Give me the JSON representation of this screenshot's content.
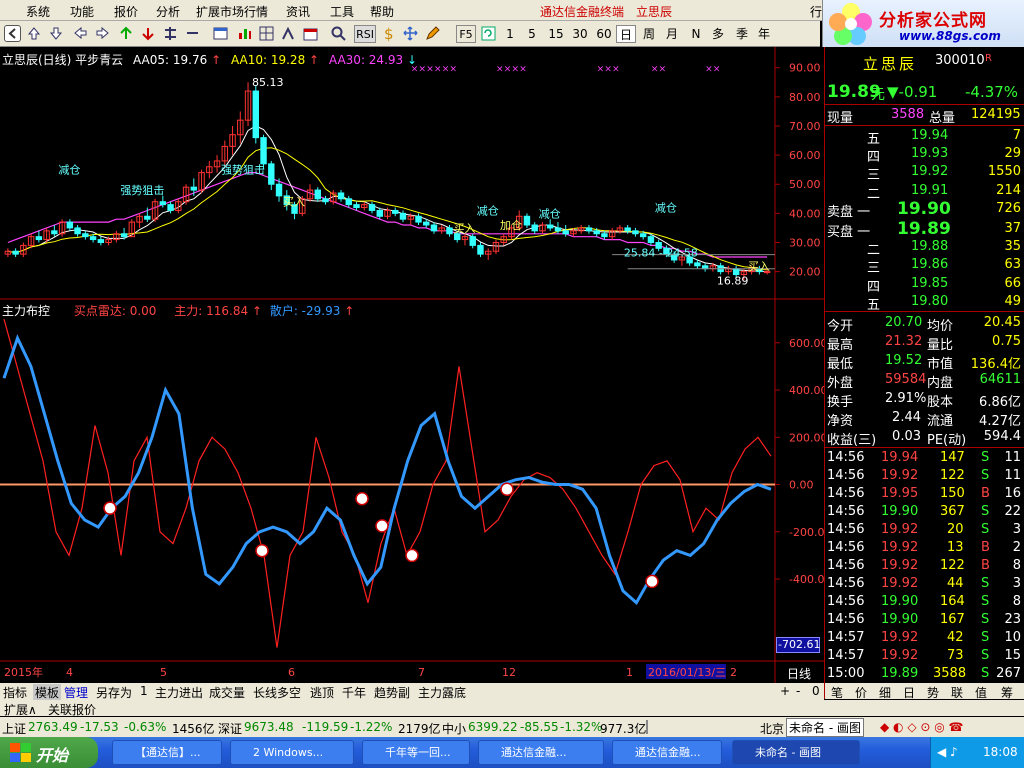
{
  "menubar": {
    "items": [
      "系统",
      "功能",
      "报价",
      "分析",
      "扩展市场行情",
      "资讯",
      "工具",
      "帮助"
    ],
    "app_title": "通达信金融终端",
    "stock_tag": "立思辰",
    "right_cut": "行"
  },
  "toolbar": {
    "buttons": [
      "RSI",
      "F5",
      "1",
      "5",
      "15",
      "30",
      "60",
      "日",
      "周",
      "月",
      "N",
      "多",
      "季",
      "年"
    ]
  },
  "logo": {
    "text": "分析家公式网",
    "url": "www.88gs.com"
  },
  "main_legend": {
    "title": "立思辰(日线) 平步青云",
    "aa05": "AA05: 19.76",
    "aa10": "AA10: 19.28",
    "aa30": "AA30: 24.93"
  },
  "sub_legend": {
    "title": "主力布控",
    "radar": "买点雷达: 0.00",
    "main": "主力: 116.84",
    "retail": "散户: -29.93"
  },
  "colors": {
    "up": "#ff3333",
    "down": "#33ffff",
    "aa05": "#ffffff",
    "aa10": "#ffff00",
    "aa30": "#ff44ff",
    "main_line": "#ff2020",
    "retail_line": "#3399ff",
    "grid": "#aa0000"
  },
  "chart_data": [
    {
      "type": "candlestick",
      "title": "立思辰(日线) 平步青云",
      "y_ticks": [
        90.0,
        80.0,
        70.0,
        60.0,
        50.0,
        40.0,
        30.0,
        20.0
      ],
      "ylim": [
        13,
        93
      ],
      "candles": [
        [
          26,
          28,
          25,
          27
        ],
        [
          27,
          28,
          25,
          26
        ],
        [
          26,
          30,
          25,
          29
        ],
        [
          29,
          33,
          28,
          32
        ],
        [
          32,
          34,
          30,
          31
        ],
        [
          31,
          35,
          30,
          34
        ],
        [
          34,
          36,
          32,
          33
        ],
        [
          33,
          38,
          32,
          37
        ],
        [
          37,
          38,
          34,
          35
        ],
        [
          35,
          36,
          32,
          33
        ],
        [
          33,
          34,
          31,
          32
        ],
        [
          32,
          33,
          30,
          31
        ],
        [
          31,
          32,
          29,
          30
        ],
        [
          30,
          32,
          29,
          31
        ],
        [
          31,
          34,
          30,
          33
        ],
        [
          33,
          35,
          31,
          32
        ],
        [
          32,
          38,
          32,
          37
        ],
        [
          37,
          40,
          35,
          39
        ],
        [
          39,
          42,
          37,
          38
        ],
        [
          38,
          45,
          37,
          44
        ],
        [
          44,
          46,
          42,
          43
        ],
        [
          43,
          44,
          40,
          41
        ],
        [
          41,
          45,
          40,
          44
        ],
        [
          44,
          50,
          43,
          49
        ],
        [
          49,
          52,
          46,
          48
        ],
        [
          48,
          55,
          47,
          54
        ],
        [
          54,
          58,
          52,
          56
        ],
        [
          56,
          60,
          54,
          58
        ],
        [
          58,
          65,
          56,
          63
        ],
        [
          63,
          70,
          60,
          67
        ],
        [
          67,
          75,
          64,
          72
        ],
        [
          72,
          85,
          70,
          82
        ],
        [
          82,
          84,
          64,
          66
        ],
        [
          66,
          67,
          55,
          57
        ],
        [
          57,
          58,
          48,
          50
        ],
        [
          50,
          52,
          44,
          46
        ],
        [
          46,
          48,
          41,
          43
        ],
        [
          43,
          44,
          38,
          40
        ],
        [
          40,
          46,
          39,
          45
        ],
        [
          45,
          50,
          44,
          48
        ],
        [
          48,
          49,
          44,
          45
        ],
        [
          45,
          46,
          43,
          44
        ],
        [
          44,
          48,
          43,
          47
        ],
        [
          47,
          48,
          44,
          45
        ],
        [
          45,
          46,
          42,
          43
        ],
        [
          43,
          44,
          41,
          42
        ],
        [
          42,
          44,
          41,
          43
        ],
        [
          43,
          44,
          40,
          41
        ],
        [
          41,
          42,
          38,
          39
        ],
        [
          39,
          42,
          38,
          41
        ],
        [
          41,
          42,
          39,
          40
        ],
        [
          40,
          41,
          37,
          38
        ],
        [
          38,
          40,
          36,
          39
        ],
        [
          39,
          40,
          36,
          37
        ],
        [
          37,
          38,
          35,
          36
        ],
        [
          36,
          37,
          33,
          34
        ],
        [
          34,
          36,
          33,
          35
        ],
        [
          35,
          36,
          32,
          33
        ],
        [
          33,
          34,
          30,
          31
        ],
        [
          31,
          33,
          29,
          32
        ],
        [
          32,
          33,
          28,
          29
        ],
        [
          29,
          30,
          25,
          26
        ],
        [
          26,
          28,
          24,
          27
        ],
        [
          27,
          31,
          26,
          30
        ],
        [
          30,
          33,
          29,
          32
        ],
        [
          32,
          36,
          31,
          35
        ],
        [
          35,
          41,
          34,
          39
        ],
        [
          39,
          40,
          35,
          36
        ],
        [
          36,
          37,
          33,
          34
        ],
        [
          34,
          37,
          33,
          36
        ],
        [
          36,
          38,
          34,
          35
        ],
        [
          35,
          37,
          33,
          34
        ],
        [
          34,
          36,
          32,
          33
        ],
        [
          33,
          35,
          32,
          34
        ],
        [
          34,
          36,
          33,
          35
        ],
        [
          35,
          36,
          33,
          34
        ],
        [
          34,
          35,
          32,
          33
        ],
        [
          33,
          34,
          31,
          32
        ],
        [
          32,
          35,
          31,
          34
        ],
        [
          34,
          36,
          33,
          35
        ],
        [
          35,
          36,
          33,
          34
        ],
        [
          34,
          35,
          32,
          33
        ],
        [
          33,
          34,
          31,
          32
        ],
        [
          32,
          33,
          29,
          30
        ],
        [
          30,
          31,
          27,
          28
        ],
        [
          28,
          29,
          25,
          26
        ],
        [
          26,
          27,
          23,
          24
        ],
        [
          24,
          26,
          22,
          25
        ],
        [
          25,
          26,
          22,
          23
        ],
        [
          23,
          24,
          21,
          22
        ],
        [
          22,
          23,
          20,
          21
        ],
        [
          21,
          23,
          20,
          22
        ],
        [
          22,
          23,
          19,
          20
        ],
        [
          20,
          22,
          19,
          21
        ],
        [
          21,
          22,
          18,
          19
        ],
        [
          19,
          21,
          17,
          20
        ],
        [
          20,
          22,
          19,
          21
        ],
        [
          21,
          22,
          19,
          20
        ],
        [
          20,
          21,
          19,
          20
        ]
      ],
      "aa30_line": [
        30,
        31,
        32,
        33,
        34,
        35,
        36,
        37,
        37,
        37,
        37,
        37,
        37,
        37,
        38,
        38,
        39,
        40,
        41,
        42,
        43,
        44,
        45,
        46,
        47,
        48,
        49,
        50,
        51,
        52,
        53,
        54,
        54,
        53,
        52,
        51,
        50,
        49,
        48,
        47,
        46,
        45,
        44,
        43,
        42,
        41,
        40,
        39,
        38,
        37,
        37,
        36,
        36,
        35,
        35,
        34,
        34,
        34,
        33,
        33,
        33,
        33,
        33,
        33,
        33,
        33,
        33,
        33,
        33,
        33,
        33,
        33,
        33,
        32,
        32,
        32,
        32,
        31,
        31,
        31,
        30,
        30,
        30,
        29,
        29,
        28,
        28,
        27,
        27,
        26,
        26,
        25,
        25,
        25,
        25,
        25,
        25,
        25,
        25
      ],
      "annotations": [
        "85.13",
        "强势狙击",
        "强势狙击",
        "减仓",
        "买入",
        "减仓",
        "买入",
        "减仓",
        "加仓",
        "减仓",
        "25.84 - 24.58",
        "买入",
        "16.89"
      ],
      "x_labels": [
        "2015年",
        "4",
        "5",
        "6",
        "7",
        "12",
        "1",
        "2016/01/13/三",
        "2"
      ]
    },
    {
      "type": "line",
      "title": "主力布控",
      "y_ticks": [
        600.0,
        400.0,
        200.0,
        0.0,
        -200.0,
        -400.0
      ],
      "ylim": [
        -730,
        760
      ],
      "series": [
        {
          "name": "主力",
          "values": [
            700,
            500,
            300,
            100,
            -200,
            -300,
            -100,
            250,
            50,
            -300,
            100,
            200,
            -200,
            -250,
            -100,
            100,
            200,
            150,
            50,
            -100,
            -300,
            -690,
            -300,
            -200,
            200,
            30,
            -200,
            -300,
            -500,
            -250,
            -100,
            -300,
            -200,
            0,
            100,
            500,
            150,
            -200,
            -150,
            -50,
            20,
            50,
            30,
            -20,
            -100,
            -200,
            -300,
            -380,
            -200,
            0,
            80,
            100,
            20,
            -200,
            -100,
            -150,
            50,
            150,
            200,
            120
          ]
        },
        {
          "name": "散户",
          "values": [
            450,
            620,
            500,
            300,
            100,
            -80,
            -150,
            -180,
            -100,
            -50,
            50,
            200,
            400,
            300,
            -100,
            -380,
            -420,
            -350,
            -250,
            -200,
            -180,
            -200,
            -250,
            -200,
            -100,
            -150,
            -300,
            -420,
            -350,
            -100,
            100,
            250,
            300,
            100,
            -50,
            -100,
            -50,
            0,
            20,
            30,
            10,
            0,
            0,
            -20,
            -100,
            -300,
            -450,
            -500,
            -400,
            -320,
            -280,
            -300,
            -250,
            -150,
            -80,
            -30,
            0,
            -20
          ]
        }
      ]
    }
  ],
  "quote": {
    "name": "立思辰",
    "code": "300010",
    "mark": "R",
    "price": "19.89",
    "unit": "元",
    "change": "▼-0.91",
    "pct": "-4.37%",
    "vol_label": "现量",
    "vol": "3588",
    "total_label": "总量",
    "total": "124195",
    "sell": [
      {
        "label": "五",
        "price": "19.94",
        "vol": "7"
      },
      {
        "label": "四",
        "price": "19.93",
        "vol": "29"
      },
      {
        "label": "三",
        "price": "19.92",
        "vol": "1550"
      },
      {
        "label": "二",
        "price": "19.91",
        "vol": "214"
      },
      {
        "label": "卖盘 一",
        "price": "19.90",
        "vol": "726"
      }
    ],
    "buy": [
      {
        "label": "买盘 一",
        "price": "19.89",
        "vol": "37"
      },
      {
        "label": "二",
        "price": "19.88",
        "vol": "35"
      },
      {
        "label": "三",
        "price": "19.86",
        "vol": "63"
      },
      {
        "label": "四",
        "price": "19.85",
        "vol": "66"
      },
      {
        "label": "五",
        "price": "19.80",
        "vol": "49"
      }
    ],
    "stats": [
      [
        "今开",
        "20.70",
        "均价",
        "20.45"
      ],
      [
        "最高",
        "21.32",
        "量比",
        "0.75"
      ],
      [
        "最低",
        "19.52",
        "市值",
        "136.4亿"
      ],
      [
        "外盘",
        "59584",
        "内盘",
        "64611"
      ],
      [
        "换手",
        "2.91%",
        "股本",
        "6.86亿"
      ],
      [
        "净资",
        "2.44",
        "流通",
        "4.27亿"
      ],
      [
        "收益(三)",
        "0.03",
        "PE(动)",
        "594.4"
      ]
    ],
    "ticks": [
      [
        "14:56",
        "19.94",
        "147",
        "S",
        "11"
      ],
      [
        "14:56",
        "19.92",
        "122",
        "S",
        "11"
      ],
      [
        "14:56",
        "19.95",
        "150",
        "B",
        "16"
      ],
      [
        "14:56",
        "19.90",
        "367",
        "S",
        "22"
      ],
      [
        "14:56",
        "19.92",
        "20",
        "S",
        "3"
      ],
      [
        "14:56",
        "19.92",
        "13",
        "B",
        "2"
      ],
      [
        "14:56",
        "19.92",
        "122",
        "B",
        "8"
      ],
      [
        "14:56",
        "19.92",
        "44",
        "S",
        "3"
      ],
      [
        "14:56",
        "19.90",
        "164",
        "S",
        "8"
      ],
      [
        "14:56",
        "19.90",
        "167",
        "S",
        "23"
      ],
      [
        "14:57",
        "19.92",
        "42",
        "S",
        "10"
      ],
      [
        "14:57",
        "19.92",
        "73",
        "S",
        "15"
      ],
      [
        "15:00",
        "19.89",
        "3588",
        "S",
        "267"
      ]
    ],
    "side_tabs": [
      "笔",
      "价",
      "细",
      "日",
      "势",
      "联",
      "值",
      "筹"
    ],
    "period_label": "日线",
    "bottom_value": "-702.61"
  },
  "bottom_tabs": [
    "指标",
    "模板",
    "管理",
    "另存为",
    "1",
    "主力进出",
    "成交量",
    "长线多空",
    "逃顶",
    "千年",
    "趋势副",
    "主力露底"
  ],
  "bottom_tabs2": [
    "扩展∧",
    "关联报价"
  ],
  "ticker": {
    "sh_label": "上证",
    "sh_val": "2763.49",
    "sh_chg": "-17.53",
    "sh_pct": "-0.63%",
    "sh_amt": "1456亿",
    "sz_label": "深证",
    "sz_val": "9673.48",
    "sz_chg": "-119.59",
    "sz_pct": "-1.22%",
    "sz_amt": "2179亿",
    "zx_label": "中小",
    "zx_val": "6399.22",
    "zx_chg": "-85.55",
    "zx_pct": "-1.32%",
    "zx_amt": "977.3亿",
    "city": "北京",
    "doc": "未命名 - 画图"
  },
  "taskbar": {
    "start": "开始",
    "tasks": [
      "【通达信】...",
      "2 Windows...",
      "千年等一回...",
      "通达信金融...",
      "通达信金融...",
      "未命名 - 画图"
    ],
    "clock": "18:08"
  }
}
